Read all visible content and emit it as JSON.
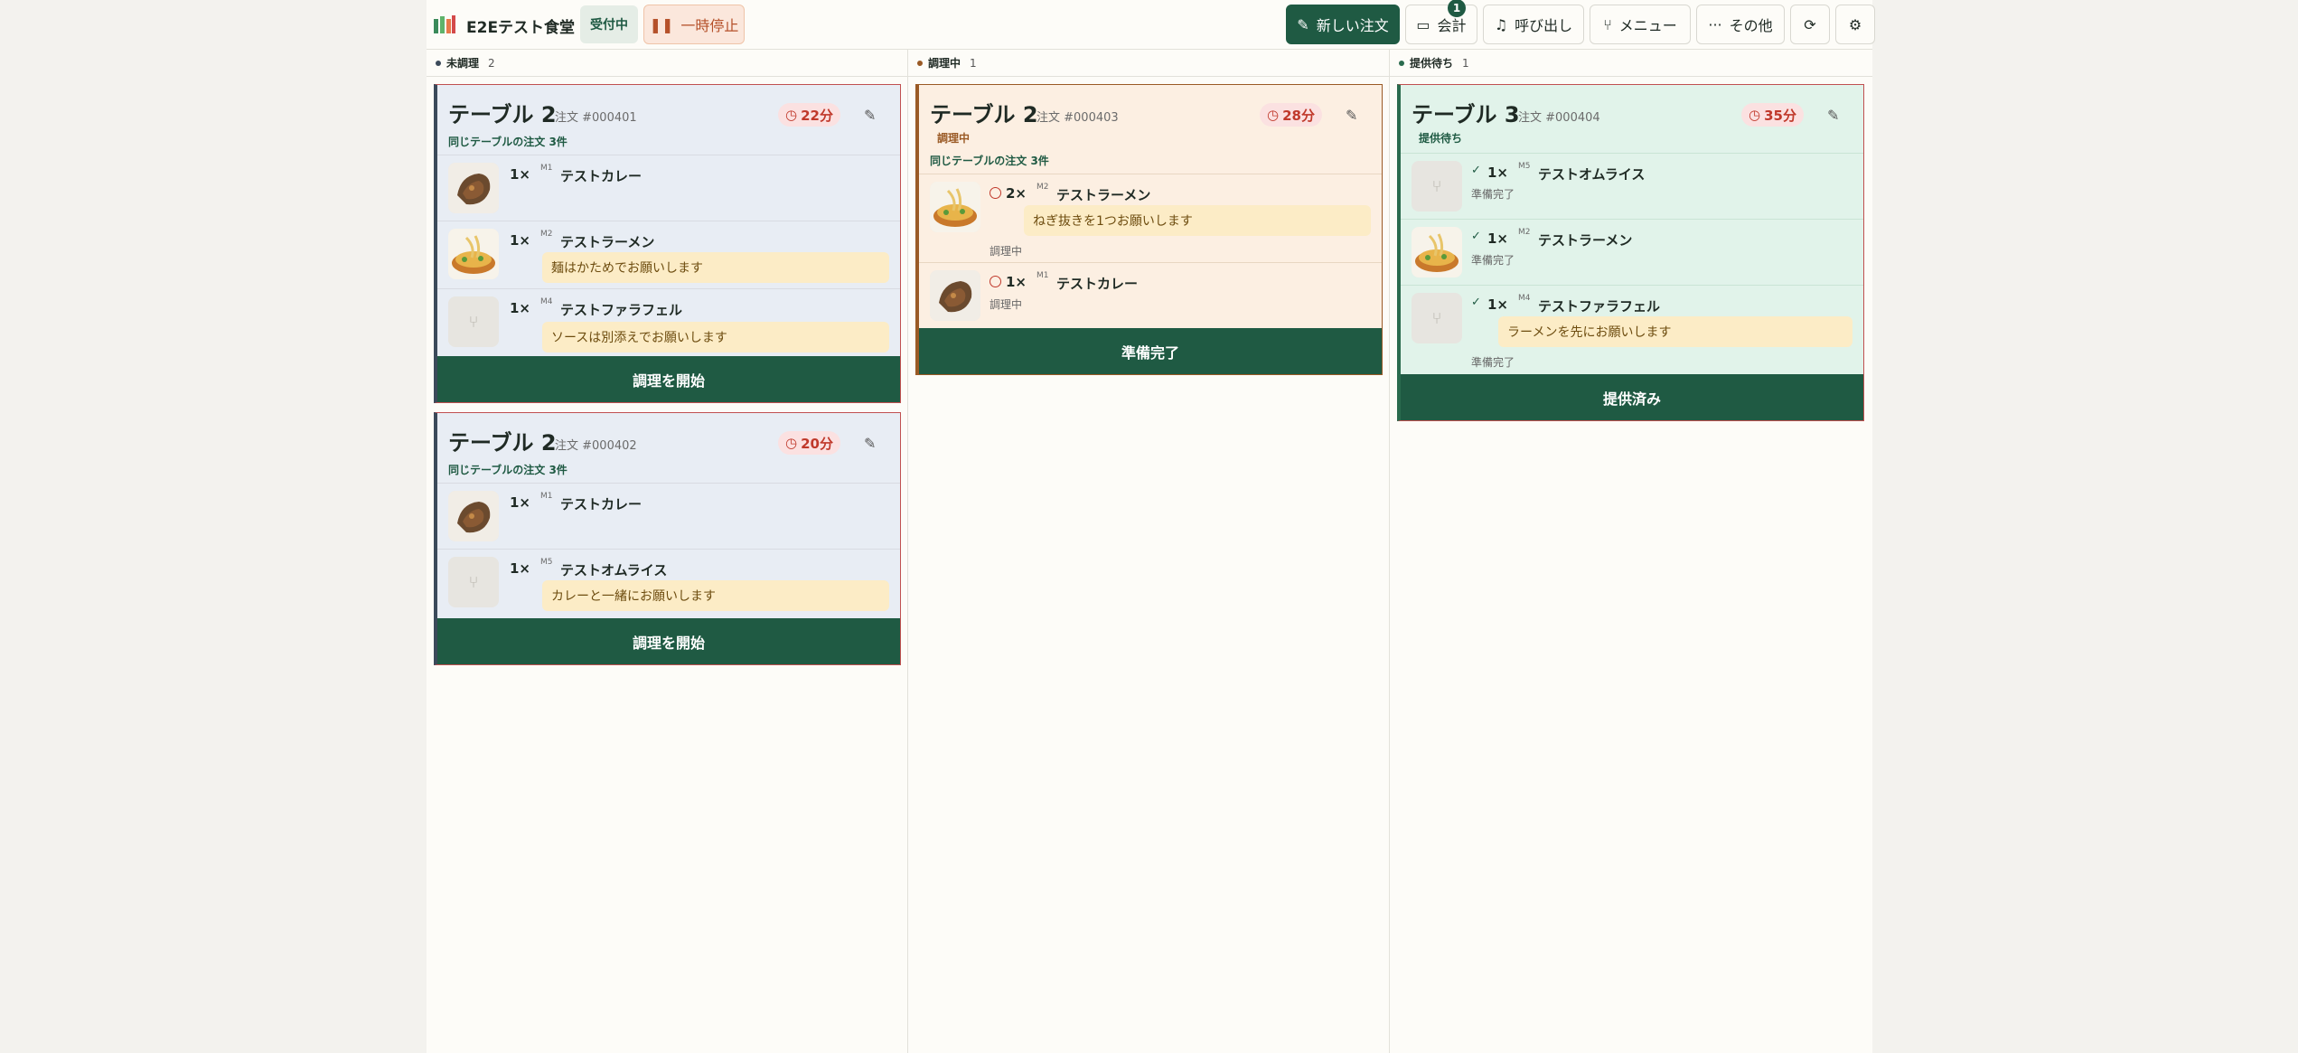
{
  "header": {
    "app_name": "E2Eテスト食堂",
    "status": "受付中",
    "pause_label": "一時停止",
    "new_order_label": "新しい注文",
    "checkout_label": "会計",
    "checkout_badge": "1",
    "call_label": "呼び出し",
    "menu_label": "メニュー",
    "more_label": "その他"
  },
  "colors": {
    "brand": "#1f5a43",
    "urgent": "#c0392b",
    "note_bg": "#fcecc6"
  },
  "columns": [
    {
      "label": "未調理",
      "count": "2",
      "dot_color": "#3b4a5a",
      "cards": [
        {
          "table": "テーブル 2",
          "order_no": "注文 #000401",
          "elapsed": "22分",
          "same_table": "同じテーブルの注文 3件",
          "action": "調理を開始",
          "items": [
            {
              "qty": "1×",
              "code": "M1",
              "name": "テストカレー",
              "note": "",
              "image": "curry"
            },
            {
              "qty": "1×",
              "code": "M2",
              "name": "テストラーメン",
              "note": "麺はかためでお願いします",
              "image": "ramen"
            },
            {
              "qty": "1×",
              "code": "M4",
              "name": "テストファラフェル",
              "note": "ソースは別添えでお願いします",
              "image": "none"
            }
          ]
        },
        {
          "table": "テーブル 2",
          "order_no": "注文 #000402",
          "elapsed": "20分",
          "same_table": "同じテーブルの注文 3件",
          "action": "調理を開始",
          "items": [
            {
              "qty": "1×",
              "code": "M1",
              "name": "テストカレー",
              "note": "",
              "image": "curry"
            },
            {
              "qty": "1×",
              "code": "M5",
              "name": "テストオムライス",
              "note": "カレーと一緒にお願いします",
              "image": "none"
            }
          ]
        }
      ]
    },
    {
      "label": "調理中",
      "count": "1",
      "dot_color": "#9a5a25",
      "cards": [
        {
          "table": "テーブル 2",
          "order_no": "注文 #000403",
          "elapsed": "28分",
          "status": "調理中",
          "same_table": "同じテーブルの注文 3件",
          "action": "準備完了",
          "items": [
            {
              "qty": "2×",
              "code": "M2",
              "name": "テストラーメン",
              "note": "ねぎ抜きを1つお願いします",
              "status": "調理中",
              "image": "ramen"
            },
            {
              "qty": "1×",
              "code": "M1",
              "name": "テストカレー",
              "note": "",
              "status": "調理中",
              "image": "curry"
            }
          ]
        }
      ]
    },
    {
      "label": "提供待ち",
      "count": "1",
      "dot_color": "#2a6b4e",
      "cards": [
        {
          "table": "テーブル 3",
          "order_no": "注文 #000404",
          "elapsed": "35分",
          "status": "提供待ち",
          "action": "提供済み",
          "items": [
            {
              "qty": "1×",
              "code": "M5",
              "name": "テストオムライス",
              "note": "",
              "status": "準備完了",
              "image": "none"
            },
            {
              "qty": "1×",
              "code": "M2",
              "name": "テストラーメン",
              "note": "",
              "status": "準備完了",
              "image": "ramen"
            },
            {
              "qty": "1×",
              "code": "M4",
              "name": "テストファラフェル",
              "note": "ラーメンを先にお願いします",
              "status": "準備完了",
              "image": "none"
            }
          ]
        }
      ]
    }
  ]
}
